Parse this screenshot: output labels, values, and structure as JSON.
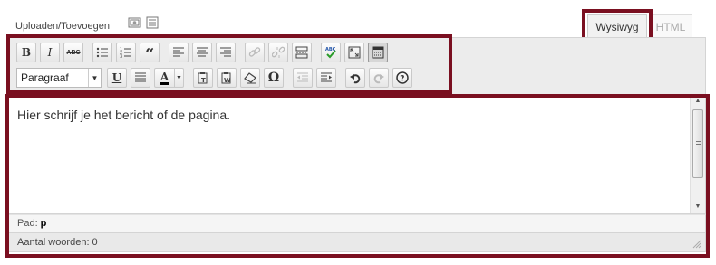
{
  "media": {
    "label": "Uploaden/Toevoegen",
    "icons": [
      "add-media-icon",
      "add-gallery-icon"
    ]
  },
  "tabs": {
    "wysiwyg": "Wysiwyg",
    "html": "HTML",
    "active": "wysiwyg"
  },
  "toolbar": {
    "row1": [
      "bold",
      "italic",
      "strikethrough",
      "bullet-list",
      "numbered-list",
      "blockquote",
      "align-left",
      "align-center",
      "align-right",
      "insert-link",
      "remove-link",
      "insert-more",
      "spellcheck",
      "fullscreen",
      "kitchen-sink"
    ],
    "bold": "B",
    "italic": "I",
    "strike": "ABC",
    "quote": "“",
    "format_select": "Paragraaf",
    "underline": "U",
    "text_color": "A",
    "omega": "Ω",
    "row2": [
      "format-select",
      "underline",
      "justify",
      "text-color",
      "paste-text",
      "paste-word",
      "remove-format",
      "special-char",
      "outdent",
      "indent",
      "undo",
      "redo",
      "help"
    ]
  },
  "editor": {
    "content": "Hier schrijf je het bericht of de pagina."
  },
  "status": {
    "path_label": "Pad:",
    "path_value": "p",
    "word_count": "Aantal woorden: 0"
  },
  "colors": {
    "highlight": "#7a0f20",
    "toolbar_bg": "#ececec",
    "spellcheck_green": "#2a9b2a"
  }
}
